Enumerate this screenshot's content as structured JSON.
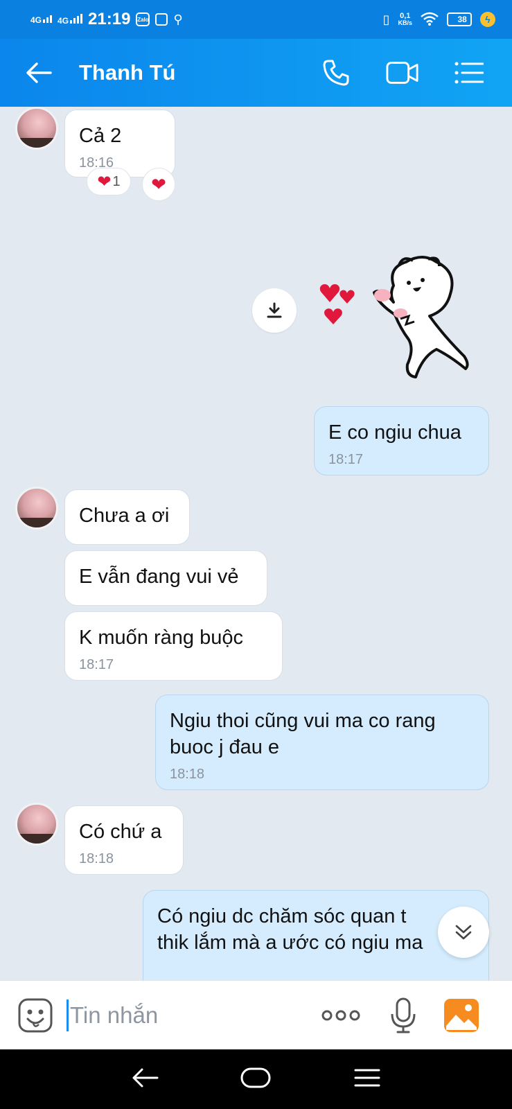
{
  "status_bar": {
    "signal1": "4G",
    "signal2": "4G",
    "time": "21:19",
    "app_badge": "Zalo",
    "net_speed_value": "0,1",
    "net_speed_unit": "KB/s",
    "battery": "38"
  },
  "header": {
    "title": "Thanh Tú"
  },
  "messages": {
    "m1": {
      "text": "Cả 2",
      "time": "18:16",
      "reaction_count": "1"
    },
    "m2": {
      "text": "E co ngiu chua",
      "time": "18:17"
    },
    "m3": {
      "text": "Chưa a ơi"
    },
    "m4": {
      "text": "E vẫn đang vui vẻ"
    },
    "m5": {
      "text": "K muốn ràng buộc",
      "time": "18:17"
    },
    "m6": {
      "line1": "Ngiu thoi cũng vui ma co rang",
      "line2": "buoc j đau e",
      "time": "18:18"
    },
    "m7": {
      "text": "Có chứ a",
      "time": "18:18"
    },
    "m8": {
      "line1": "Có ngiu dc chăm sóc quan t",
      "line2": "thik lắm mà a ước có ngiu ma"
    }
  },
  "input": {
    "placeholder": "Tin nhắn"
  },
  "colors": {
    "header": "#0b86ec",
    "outgoing_bubble": "#d4ecfd",
    "incoming_bubble": "#ffffff",
    "chat_bg": "#e2e9f1",
    "heart": "#e0193c"
  }
}
